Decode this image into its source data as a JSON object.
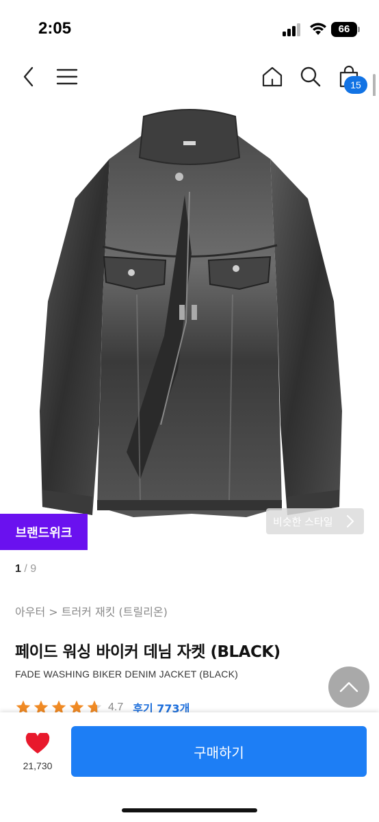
{
  "status_bar": {
    "time": "2:05",
    "battery": "66"
  },
  "nav": {
    "cart_count": "15"
  },
  "product": {
    "brand_week_label": "브랜드위크",
    "similar_style_label": "비슷한 스타일",
    "image_current": "1",
    "image_total": "/ 9",
    "breadcrumb": "아우터 > 트러커 재킷 (트릴리온)",
    "title_ko": "페이드 워싱 바이커 데님 자켓 (BLACK)",
    "title_en": "FADE WASHING BIKER DENIM JACKET (BLACK)",
    "rating_value": "4.7",
    "rating_stars": 4.7,
    "reviews_label": "후기 773개"
  },
  "bottom_bar": {
    "wish_count": "21,730",
    "buy_label": "구매하기"
  },
  "colors": {
    "accent_blue": "#1d7ef5",
    "brand_purple": "#6a11ef",
    "star_orange": "#f08a24",
    "heart_red": "#e8192c"
  },
  "icons": [
    "back-icon",
    "menu-icon",
    "home-icon",
    "search-icon",
    "cart-icon",
    "chevron-right-icon",
    "chevron-up-icon",
    "heart-icon",
    "star-icon"
  ]
}
